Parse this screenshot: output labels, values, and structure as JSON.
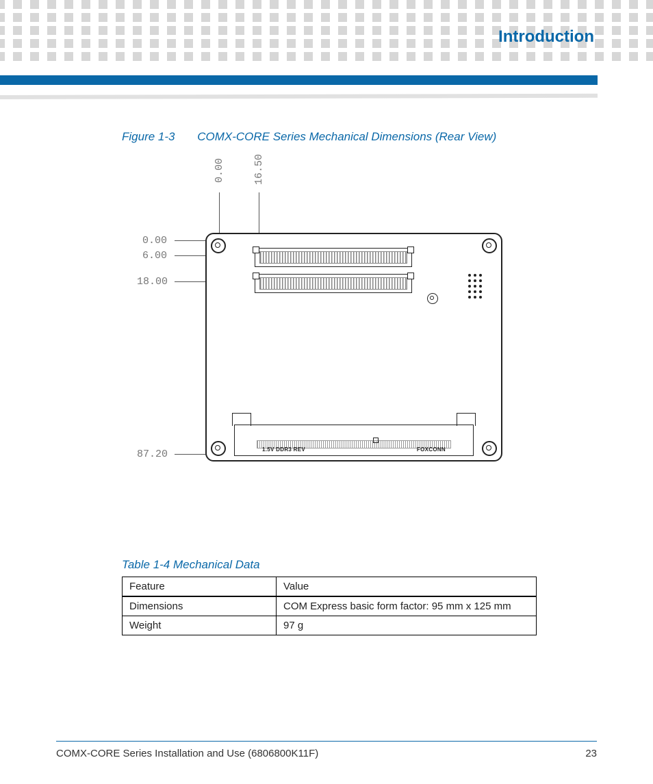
{
  "header": {
    "chapter_title": "Introduction"
  },
  "figure": {
    "number": "Figure 1-3",
    "title": "COMX-CORE Series Mechanical Dimensions (Rear View)",
    "dim_top_1": "0.00",
    "dim_top_2": "16.50",
    "dim_left_1": "0.00",
    "dim_left_2": "6.00",
    "dim_left_3": "18.00",
    "dim_left_4": "87.20",
    "slot_label_left": "1.5V  DDR3  REV",
    "slot_label_right": "FOXCONN"
  },
  "table": {
    "caption": "Table 1-4 Mechanical Data",
    "headers": {
      "c1": "Feature",
      "c2": "Value"
    },
    "rows": [
      {
        "feature": "Dimensions",
        "value": "COM Express basic form factor: 95  mm x 125 mm"
      },
      {
        "feature": "Weight",
        "value": "97 g"
      }
    ]
  },
  "footer": {
    "left": "COMX-CORE Series Installation and Use (6806800K11F)",
    "page": "23"
  }
}
